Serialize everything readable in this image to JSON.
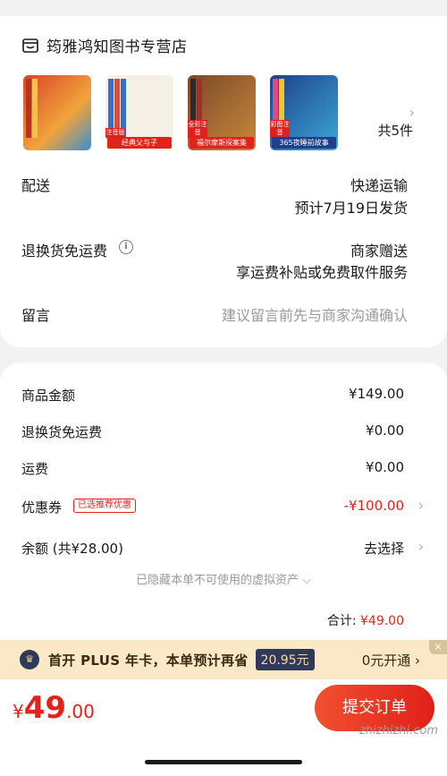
{
  "shop": {
    "name": "筠雅鸿知图书专营店",
    "products": [
      {
        "tag": "",
        "badge": ""
      },
      {
        "tag": "经典父与子",
        "badge": "注音版"
      },
      {
        "tag": "福尔摩斯探案集",
        "badge": "全彩注音"
      },
      {
        "tag": "365夜睡前故事",
        "badge": "彩图注音"
      }
    ],
    "count_label": "共5件"
  },
  "delivery": {
    "label": "配送",
    "method": "快递运输",
    "eta": "预计7月19日发货"
  },
  "return_shipping": {
    "label": "退换货免运费",
    "value": "商家赠送",
    "detail": "享运费补贴或免费取件服务"
  },
  "message": {
    "label": "留言",
    "placeholder": "建议留言前先与商家沟通确认"
  },
  "costs": {
    "goods_label": "商品金额",
    "goods_value": "¥149.00",
    "return_label": "退换货免运费",
    "return_value": "¥0.00",
    "freight_label": "运费",
    "freight_value": "¥0.00",
    "coupon_label": "优惠券",
    "coupon_tag": "已选推荐优惠",
    "coupon_value": "-¥100.00",
    "balance_label": "余额 (共¥28.00)",
    "balance_value": "去选择",
    "hidden_note": "已隐藏本单不可使用的虚拟资产 ⌵",
    "total_label": "合计:",
    "total_value": "¥49.00"
  },
  "plus": {
    "logo": "♛",
    "text": "首开 PLUS 年卡，本单预计再省",
    "amount": "20.95元",
    "open": "0元开通 ›",
    "close": "×"
  },
  "footer": {
    "currency": "¥",
    "price_int": "49",
    "price_dec": ".00",
    "submit": "提交订单",
    "watermark": "zhizhizhi.com"
  },
  "colors": {
    "accent_red": "#e2231a",
    "plus_bg": "#fbe8c6",
    "plus_navy": "#2f3a5a"
  }
}
